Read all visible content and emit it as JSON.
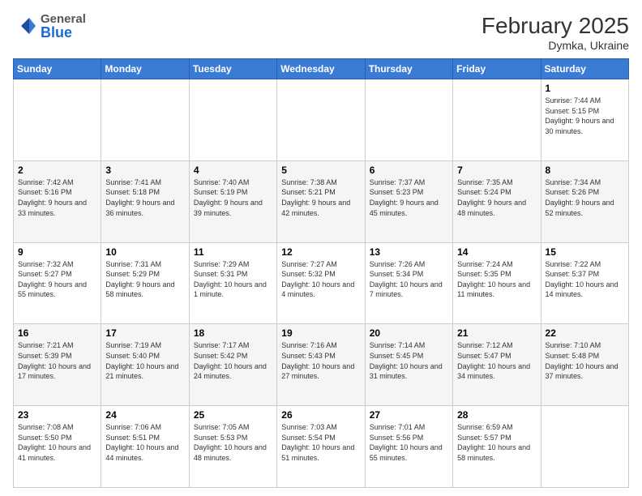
{
  "header": {
    "logo_general": "General",
    "logo_blue": "Blue",
    "month_year": "February 2025",
    "location": "Dymka, Ukraine"
  },
  "days_of_week": [
    "Sunday",
    "Monday",
    "Tuesday",
    "Wednesday",
    "Thursday",
    "Friday",
    "Saturday"
  ],
  "weeks": [
    [
      {
        "day": "",
        "info": ""
      },
      {
        "day": "",
        "info": ""
      },
      {
        "day": "",
        "info": ""
      },
      {
        "day": "",
        "info": ""
      },
      {
        "day": "",
        "info": ""
      },
      {
        "day": "",
        "info": ""
      },
      {
        "day": "1",
        "info": "Sunrise: 7:44 AM\nSunset: 5:15 PM\nDaylight: 9 hours and 30 minutes."
      }
    ],
    [
      {
        "day": "2",
        "info": "Sunrise: 7:42 AM\nSunset: 5:16 PM\nDaylight: 9 hours and 33 minutes."
      },
      {
        "day": "3",
        "info": "Sunrise: 7:41 AM\nSunset: 5:18 PM\nDaylight: 9 hours and 36 minutes."
      },
      {
        "day": "4",
        "info": "Sunrise: 7:40 AM\nSunset: 5:19 PM\nDaylight: 9 hours and 39 minutes."
      },
      {
        "day": "5",
        "info": "Sunrise: 7:38 AM\nSunset: 5:21 PM\nDaylight: 9 hours and 42 minutes."
      },
      {
        "day": "6",
        "info": "Sunrise: 7:37 AM\nSunset: 5:23 PM\nDaylight: 9 hours and 45 minutes."
      },
      {
        "day": "7",
        "info": "Sunrise: 7:35 AM\nSunset: 5:24 PM\nDaylight: 9 hours and 48 minutes."
      },
      {
        "day": "8",
        "info": "Sunrise: 7:34 AM\nSunset: 5:26 PM\nDaylight: 9 hours and 52 minutes."
      }
    ],
    [
      {
        "day": "9",
        "info": "Sunrise: 7:32 AM\nSunset: 5:27 PM\nDaylight: 9 hours and 55 minutes."
      },
      {
        "day": "10",
        "info": "Sunrise: 7:31 AM\nSunset: 5:29 PM\nDaylight: 9 hours and 58 minutes."
      },
      {
        "day": "11",
        "info": "Sunrise: 7:29 AM\nSunset: 5:31 PM\nDaylight: 10 hours and 1 minute."
      },
      {
        "day": "12",
        "info": "Sunrise: 7:27 AM\nSunset: 5:32 PM\nDaylight: 10 hours and 4 minutes."
      },
      {
        "day": "13",
        "info": "Sunrise: 7:26 AM\nSunset: 5:34 PM\nDaylight: 10 hours and 7 minutes."
      },
      {
        "day": "14",
        "info": "Sunrise: 7:24 AM\nSunset: 5:35 PM\nDaylight: 10 hours and 11 minutes."
      },
      {
        "day": "15",
        "info": "Sunrise: 7:22 AM\nSunset: 5:37 PM\nDaylight: 10 hours and 14 minutes."
      }
    ],
    [
      {
        "day": "16",
        "info": "Sunrise: 7:21 AM\nSunset: 5:39 PM\nDaylight: 10 hours and 17 minutes."
      },
      {
        "day": "17",
        "info": "Sunrise: 7:19 AM\nSunset: 5:40 PM\nDaylight: 10 hours and 21 minutes."
      },
      {
        "day": "18",
        "info": "Sunrise: 7:17 AM\nSunset: 5:42 PM\nDaylight: 10 hours and 24 minutes."
      },
      {
        "day": "19",
        "info": "Sunrise: 7:16 AM\nSunset: 5:43 PM\nDaylight: 10 hours and 27 minutes."
      },
      {
        "day": "20",
        "info": "Sunrise: 7:14 AM\nSunset: 5:45 PM\nDaylight: 10 hours and 31 minutes."
      },
      {
        "day": "21",
        "info": "Sunrise: 7:12 AM\nSunset: 5:47 PM\nDaylight: 10 hours and 34 minutes."
      },
      {
        "day": "22",
        "info": "Sunrise: 7:10 AM\nSunset: 5:48 PM\nDaylight: 10 hours and 37 minutes."
      }
    ],
    [
      {
        "day": "23",
        "info": "Sunrise: 7:08 AM\nSunset: 5:50 PM\nDaylight: 10 hours and 41 minutes."
      },
      {
        "day": "24",
        "info": "Sunrise: 7:06 AM\nSunset: 5:51 PM\nDaylight: 10 hours and 44 minutes."
      },
      {
        "day": "25",
        "info": "Sunrise: 7:05 AM\nSunset: 5:53 PM\nDaylight: 10 hours and 48 minutes."
      },
      {
        "day": "26",
        "info": "Sunrise: 7:03 AM\nSunset: 5:54 PM\nDaylight: 10 hours and 51 minutes."
      },
      {
        "day": "27",
        "info": "Sunrise: 7:01 AM\nSunset: 5:56 PM\nDaylight: 10 hours and 55 minutes."
      },
      {
        "day": "28",
        "info": "Sunrise: 6:59 AM\nSunset: 5:57 PM\nDaylight: 10 hours and 58 minutes."
      },
      {
        "day": "",
        "info": ""
      }
    ]
  ]
}
